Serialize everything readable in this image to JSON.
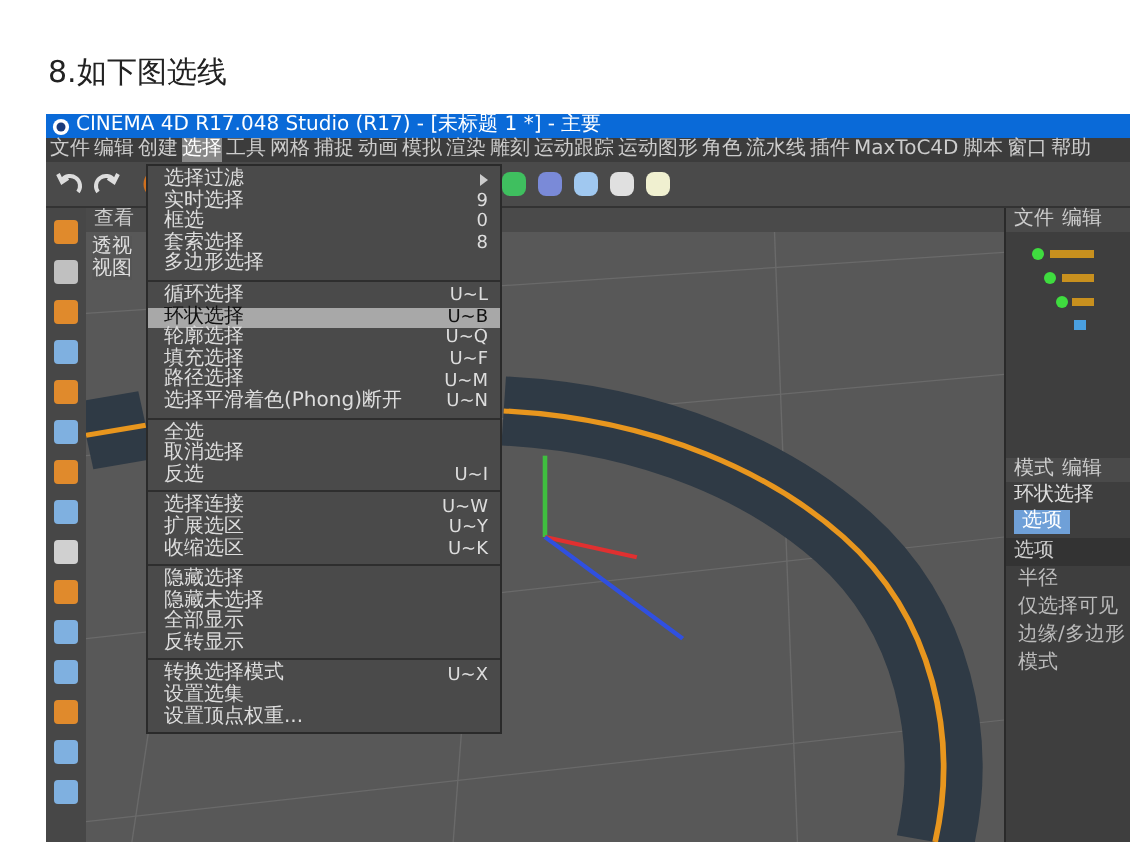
{
  "heading": "8.如下图选线",
  "window": {
    "title": "CINEMA 4D R17.048 Studio (R17) - [未标题 1 *] - 主要"
  },
  "menu_bar": [
    {
      "label": "文件",
      "selected": false
    },
    {
      "label": "编辑",
      "selected": false
    },
    {
      "label": "创建",
      "selected": false
    },
    {
      "label": "选择",
      "selected": true
    },
    {
      "label": "工具",
      "selected": false
    },
    {
      "label": "网格",
      "selected": false
    },
    {
      "label": "捕捉",
      "selected": false
    },
    {
      "label": "动画",
      "selected": false
    },
    {
      "label": "模拟",
      "selected": false
    },
    {
      "label": "渲染",
      "selected": false
    },
    {
      "label": "雕刻",
      "selected": false
    },
    {
      "label": "运动跟踪",
      "selected": false
    },
    {
      "label": "运动图形",
      "selected": false
    },
    {
      "label": "角色",
      "selected": false
    },
    {
      "label": "流水线",
      "selected": false
    },
    {
      "label": "插件",
      "selected": false
    },
    {
      "label": "MaxToC4D",
      "selected": false
    },
    {
      "label": "脚本",
      "selected": false
    },
    {
      "label": "窗口",
      "selected": false
    },
    {
      "label": "帮助",
      "selected": false
    }
  ],
  "dropdown": [
    {
      "kind": "submenu",
      "label": "选择过滤",
      "selected": false
    },
    {
      "kind": "item",
      "label": "实时选择",
      "shortcut": "9",
      "selected": false
    },
    {
      "kind": "item",
      "label": "框选",
      "shortcut": "0",
      "selected": false
    },
    {
      "kind": "item",
      "label": "套索选择",
      "shortcut": "8",
      "selected": false
    },
    {
      "kind": "item",
      "label": "多边形选择",
      "selected": false
    },
    {
      "kind": "separator"
    },
    {
      "kind": "item",
      "label": "循环选择",
      "shortcut": "U~L",
      "selected": false
    },
    {
      "kind": "item",
      "label": "环状选择",
      "shortcut": "U~B",
      "selected": true
    },
    {
      "kind": "item",
      "label": "轮廓选择",
      "shortcut": "U~Q",
      "selected": false
    },
    {
      "kind": "item",
      "label": "填充选择",
      "shortcut": "U~F",
      "selected": false
    },
    {
      "kind": "item",
      "label": "路径选择",
      "shortcut": "U~M",
      "selected": false
    },
    {
      "kind": "item",
      "label": "选择平滑着色(Phong)断开",
      "shortcut": "U~N",
      "selected": false
    },
    {
      "kind": "separator"
    },
    {
      "kind": "item",
      "label": "全选",
      "selected": false
    },
    {
      "kind": "item",
      "label": "取消选择",
      "selected": false
    },
    {
      "kind": "item",
      "label": "反选",
      "shortcut": "U~I",
      "selected": false
    },
    {
      "kind": "separator"
    },
    {
      "kind": "item",
      "label": "选择连接",
      "shortcut": "U~W",
      "selected": false
    },
    {
      "kind": "item",
      "label": "扩展选区",
      "shortcut": "U~Y",
      "selected": false
    },
    {
      "kind": "item",
      "label": "收缩选区",
      "shortcut": "U~K",
      "selected": false
    },
    {
      "kind": "separator"
    },
    {
      "kind": "item",
      "label": "隐藏选择",
      "selected": false
    },
    {
      "kind": "item",
      "label": "隐藏未选择",
      "selected": false
    },
    {
      "kind": "item",
      "label": "全部显示",
      "selected": false
    },
    {
      "kind": "item",
      "label": "反转显示",
      "selected": false
    },
    {
      "kind": "separator"
    },
    {
      "kind": "item",
      "label": "转换选择模式",
      "shortcut": "U~X",
      "selected": false
    },
    {
      "kind": "item",
      "label": "设置选集",
      "selected": false
    },
    {
      "kind": "item",
      "label": "设置顶点权重...",
      "selected": false
    }
  ],
  "viewport": {
    "menu": "查看",
    "label": "透视视图"
  },
  "right_panel": {
    "objects_menu": [
      "文件",
      "编辑"
    ],
    "attributes_menu": [
      "模式",
      "编辑"
    ],
    "tool_title": "环状选择",
    "tabs": [
      {
        "label": "选项",
        "selected": true
      }
    ],
    "section": "选项",
    "fields": [
      "半径",
      "仅选择可见",
      "边缘/多边形",
      "模式"
    ]
  }
}
